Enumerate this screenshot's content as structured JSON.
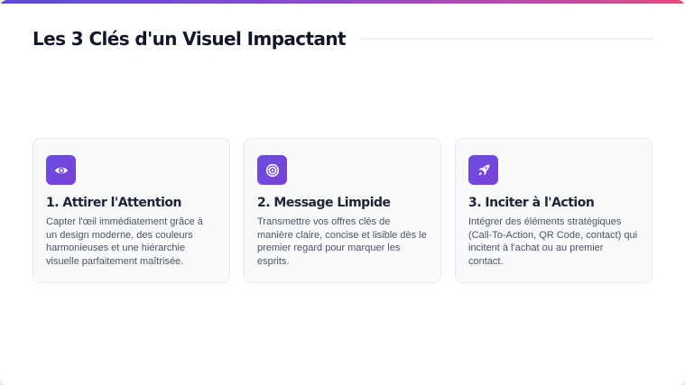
{
  "header": {
    "title": "Les 3 Clés d'un Visuel Impactant"
  },
  "cards": [
    {
      "icon": "eye-icon",
      "title": "1. Attirer l'Attention",
      "text": "Capter l'œil immédiatement grâce à un design moderne, des couleurs harmonieuses et une hiérarchie visuelle parfaitement maîtrisée."
    },
    {
      "icon": "target-icon",
      "title": "2. Message Limpide",
      "text": "Transmettre vos offres clés de manière claire, concise et lisible dès le premier regard pour marquer les esprits."
    },
    {
      "icon": "rocket-icon",
      "title": "3. Inciter à l'Action",
      "text": "Intégrer des éléments stratégiques (Call-To-Action, QR Code, contact) qui incitent à l'achat ou au premier contact."
    }
  ],
  "colors": {
    "accent": "#6a4fe0",
    "gradient_start": "#5b4bd6",
    "gradient_end": "#e04a7c",
    "title": "#101828",
    "card_background": "#f8f9fb"
  }
}
